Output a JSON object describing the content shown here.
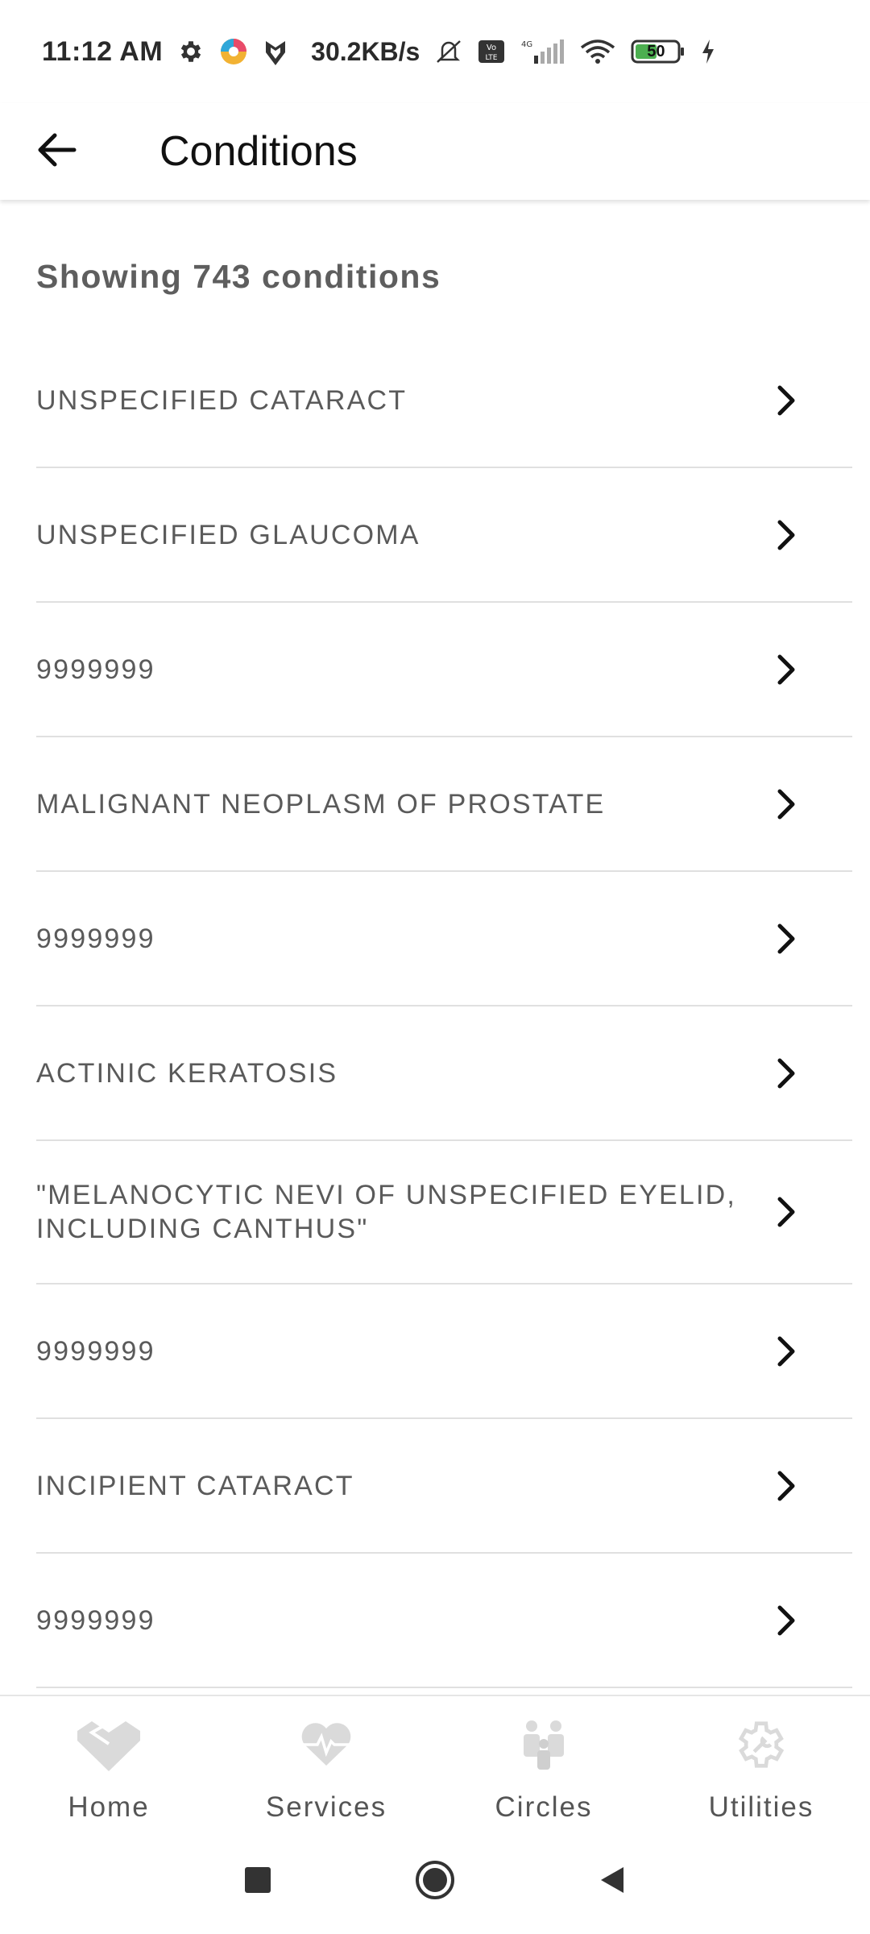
{
  "status_bar": {
    "time": "11:12 AM",
    "net_speed": "30.2KB/s",
    "battery_level": "50",
    "icons": [
      "gear-icon",
      "app-colorful-icon",
      "shield-app-icon",
      "mute-icon",
      "volte-icon",
      "signal-4g-icon",
      "wifi-icon",
      "battery-icon",
      "charging-icon"
    ]
  },
  "app_bar": {
    "title": "Conditions",
    "back_icon": "arrow-left-icon"
  },
  "summary": {
    "text": "Showing 743 conditions"
  },
  "conditions": [
    {
      "label": "UNSPECIFIED CATARACT"
    },
    {
      "label": "UNSPECIFIED GLAUCOMA"
    },
    {
      "label": "9999999"
    },
    {
      "label": "MALIGNANT NEOPLASM OF PROSTATE"
    },
    {
      "label": "9999999"
    },
    {
      "label": "ACTINIC KERATOSIS"
    },
    {
      "label": "\"MELANOCYTIC NEVI OF UNSPECIFIED EYELID, INCLUDING CANTHUS\""
    },
    {
      "label": "9999999"
    },
    {
      "label": "INCIPIENT CATARACT"
    },
    {
      "label": "9999999"
    }
  ],
  "bottom_nav": {
    "items": [
      {
        "label": "Home",
        "icon": "home-icon"
      },
      {
        "label": "Services",
        "icon": "heart-pulse-icon"
      },
      {
        "label": "Circles",
        "icon": "people-icon"
      },
      {
        "label": "Utilities",
        "icon": "gear-wrench-icon"
      }
    ]
  },
  "colors": {
    "text_primary": "#111111",
    "text_secondary": "#5a5a5a",
    "divider": "#e0e0e0",
    "nav_icon": "#d9d9d9",
    "battery_green": "#4caf50"
  }
}
